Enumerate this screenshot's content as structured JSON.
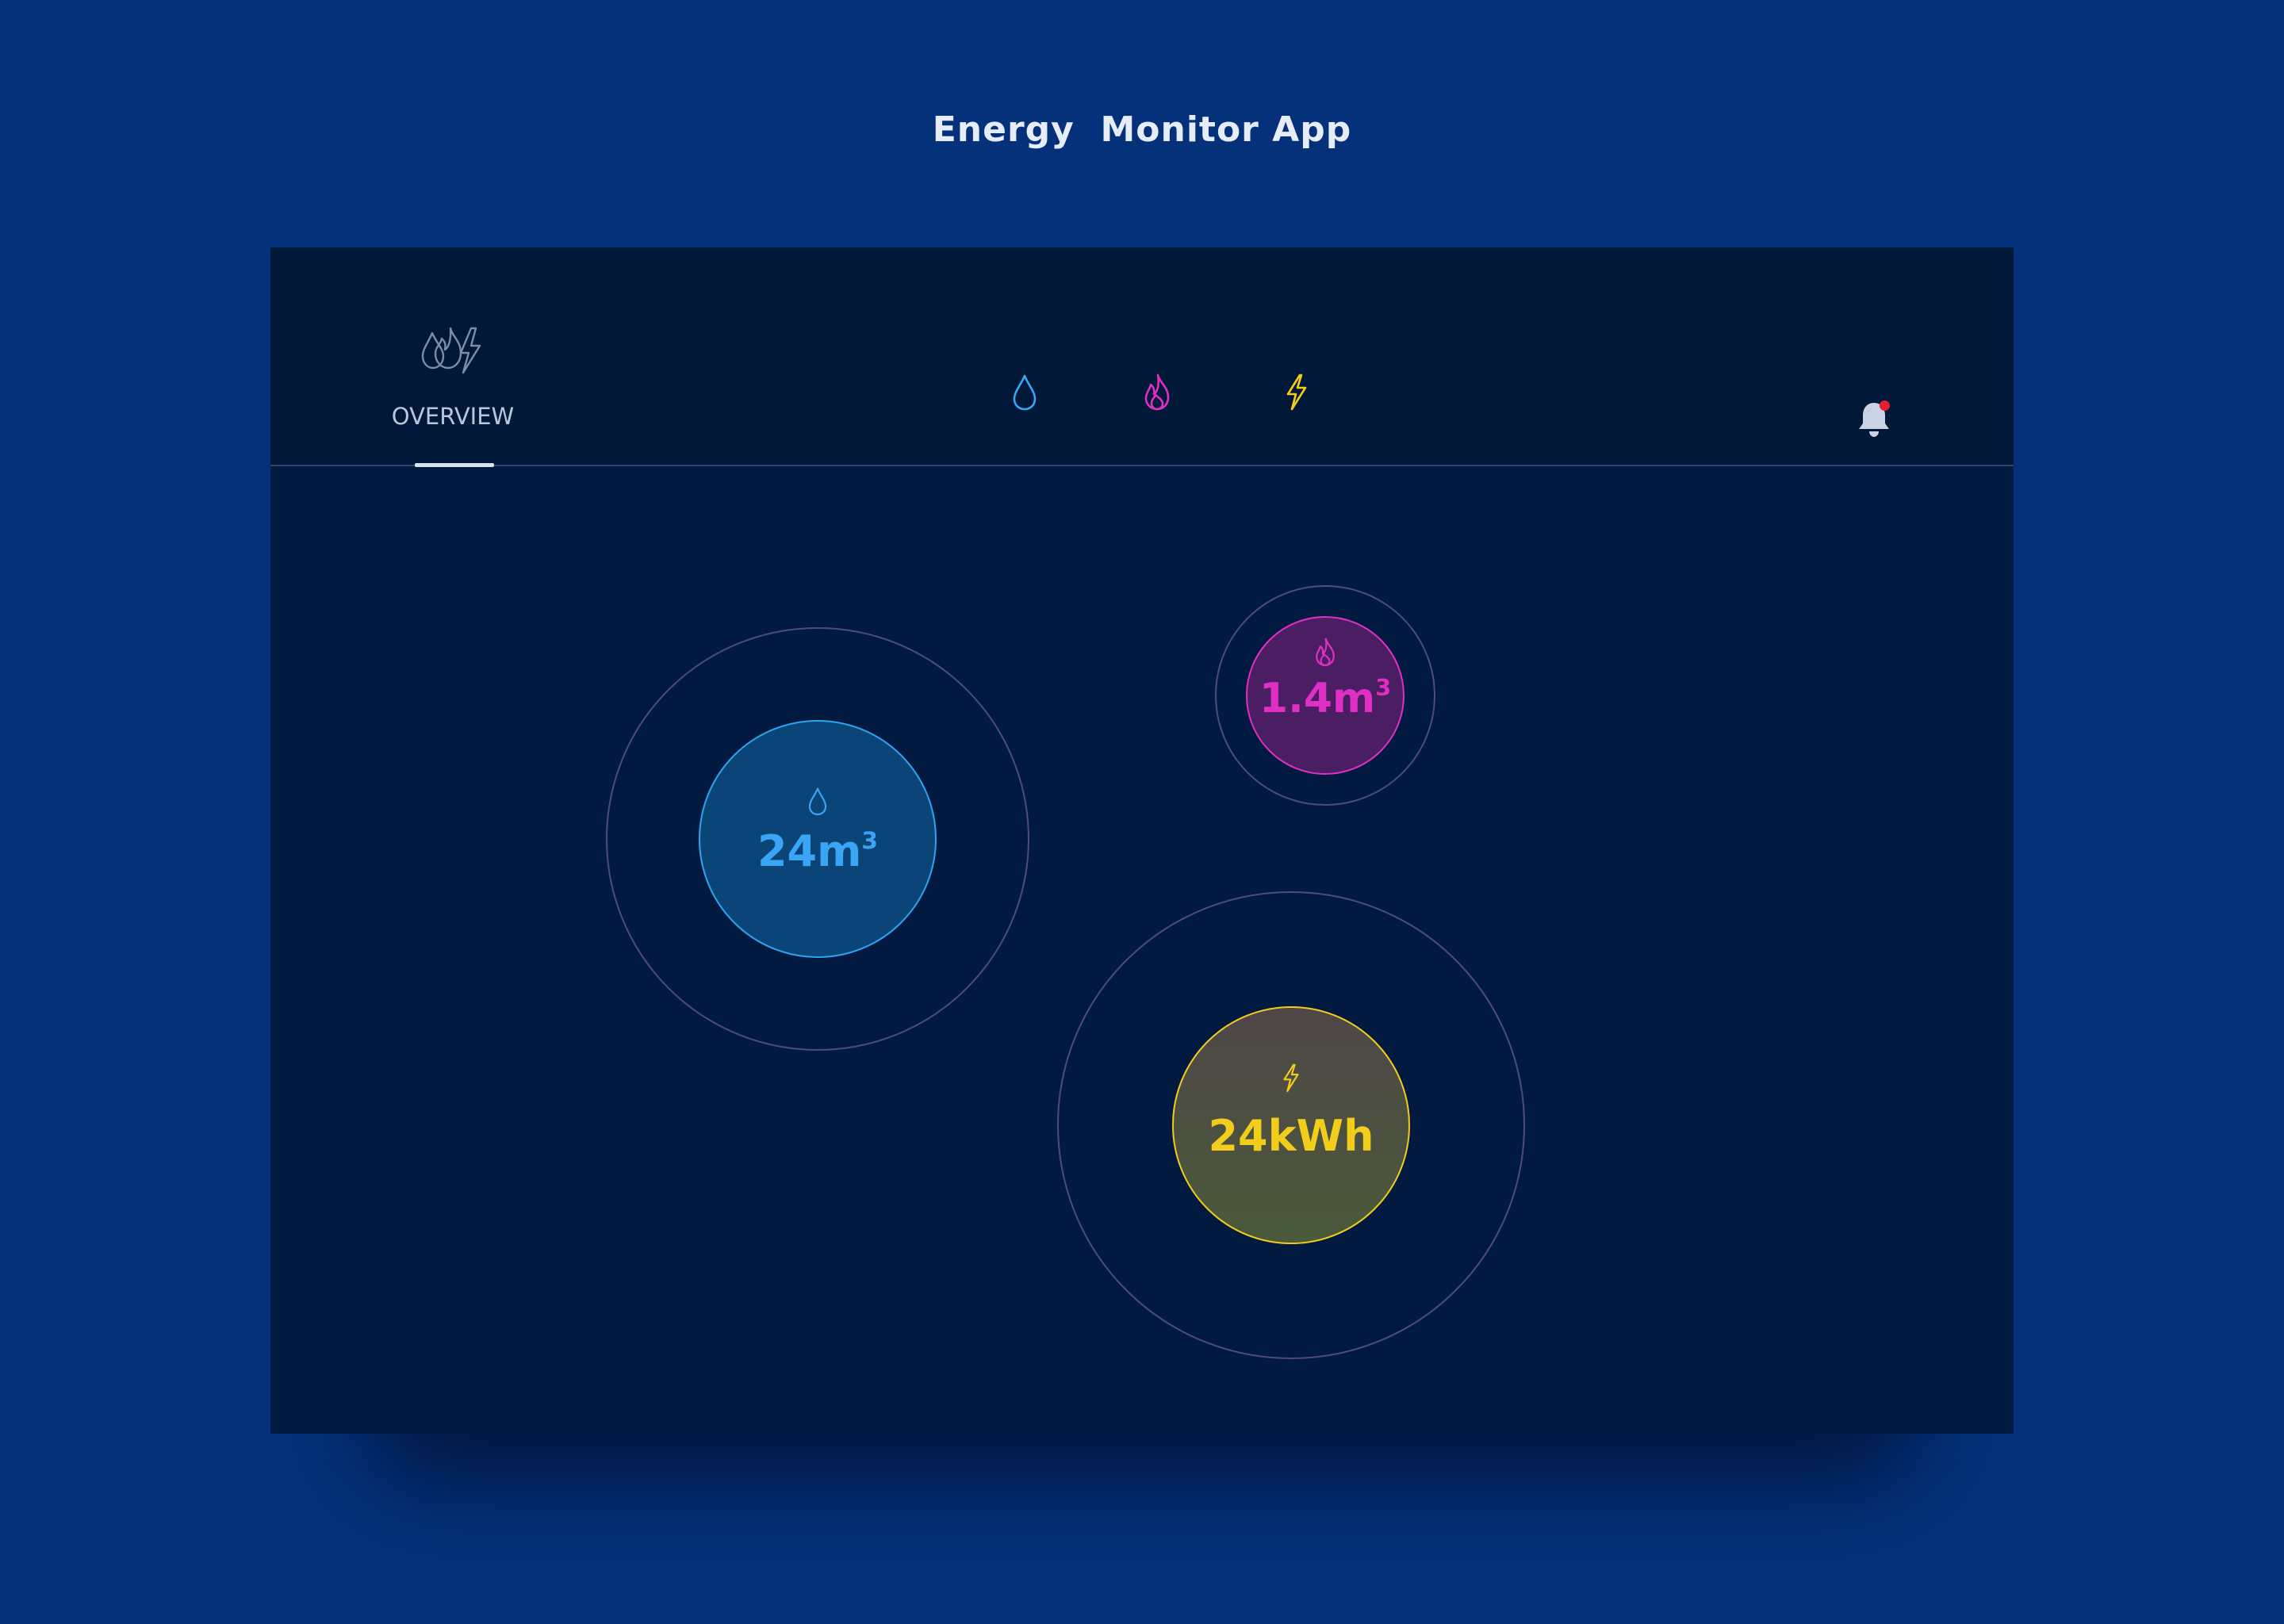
{
  "page": {
    "title": "Energy  Monitor App"
  },
  "header": {
    "overview_tab": {
      "label": "OVERVIEW",
      "icon": "water-gas-electricity-icon",
      "active": true
    },
    "tabs": [
      {
        "id": "water",
        "icon": "water-drop-icon",
        "color": "#3aa5f5"
      },
      {
        "id": "gas",
        "icon": "flame-icon",
        "color": "#e02fc5"
      },
      {
        "id": "electricity",
        "icon": "lightning-icon",
        "color": "#f2cd1c"
      }
    ],
    "notifications": {
      "icon": "bell-icon",
      "has_unread": true,
      "dot_color": "#e3202f"
    }
  },
  "bubbles": {
    "water": {
      "value": "24m",
      "unit_superscript": "3",
      "icon": "water-drop-icon",
      "color": "#3aa5f5"
    },
    "gas": {
      "value": "1.4m",
      "unit_superscript": "3",
      "icon": "flame-icon",
      "color": "#e02fc5"
    },
    "electricity": {
      "value": "24kWh",
      "icon": "lightning-icon",
      "color": "#f2cd1c"
    }
  },
  "colors": {
    "page_background": "#04317a",
    "app_background": "#031a40",
    "header_background": "#021838",
    "ring": "#4f4a7e"
  }
}
